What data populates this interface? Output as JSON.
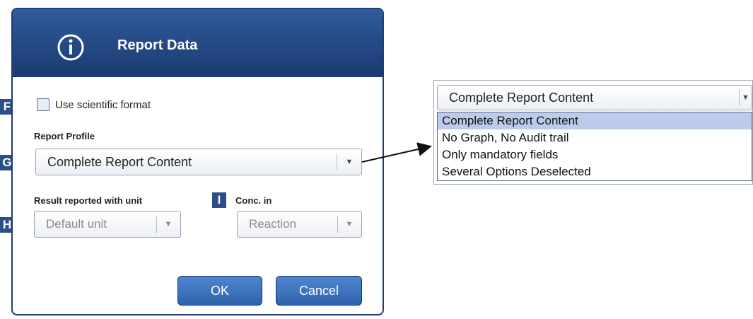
{
  "dialog": {
    "title": "Report Data",
    "scientific_format_label": "Use scientific format",
    "scientific_format_checked": false,
    "report_profile_label": "Report Profile",
    "report_profile_value": "Complete Report Content",
    "result_unit_label": "Result reported with unit",
    "result_unit_value": "Default unit",
    "conc_label": "Conc. in",
    "conc_value": "Reaction",
    "ok_label": "OK",
    "cancel_label": "Cancel",
    "icon": "info-icon",
    "header_color": "#1f3f76",
    "button_color": "#3a6fbf"
  },
  "markers": {
    "f": "F",
    "g": "G",
    "h": "H",
    "i": "I"
  },
  "dropdown_expanded": {
    "value": "Complete Report Content",
    "options": [
      "Complete Report Content",
      "No Graph, No Audit trail",
      "Only mandatory fields",
      "Several Options Deselected"
    ],
    "selected_index": 0
  },
  "icons": {
    "dropdown_arrow": "▼"
  }
}
